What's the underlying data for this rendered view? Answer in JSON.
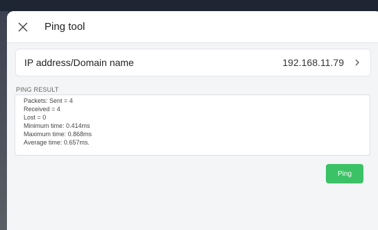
{
  "header": {
    "title": "Ping tool",
    "close_icon": "close-icon"
  },
  "target": {
    "label": "IP address/Domain name",
    "value": "192.168.11.79",
    "chevron_icon": "chevron-right-icon"
  },
  "result": {
    "section_label": "PING RESULT",
    "lines": [
      "Packets: Sent = 4",
      "Received = 4",
      "Lost = 0",
      "Minimum time: 0.414ms",
      "Maximum time: 0.868ms",
      "Average time: 0.657ms."
    ]
  },
  "actions": {
    "ping_label": "Ping",
    "ping_color": "#3cc266"
  }
}
